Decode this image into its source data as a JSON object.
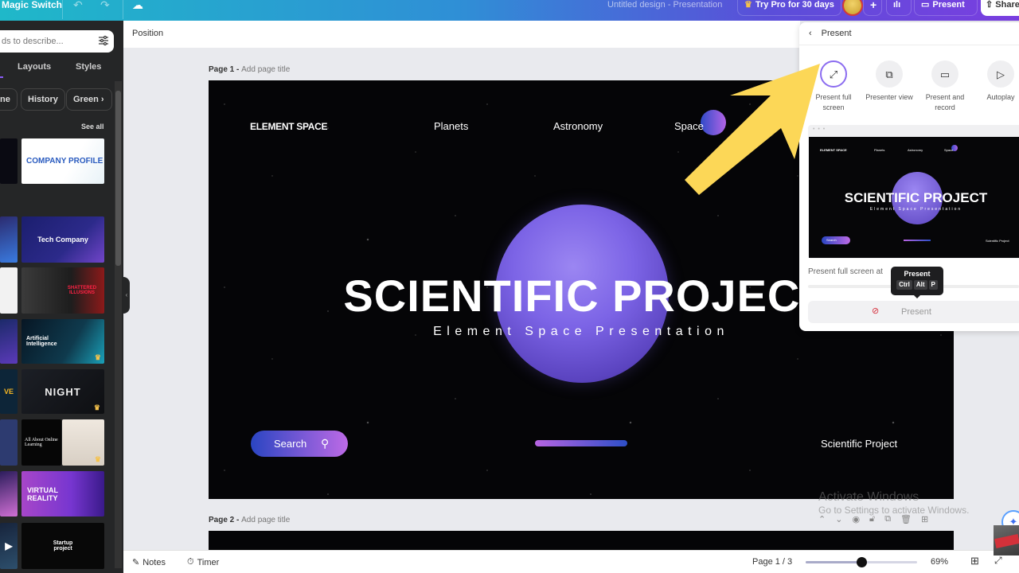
{
  "topbar": {
    "magic_switch": "Magic Switch",
    "undo_icon": "undo-icon",
    "redo_icon": "redo-icon",
    "cloud_icon": "cloud-sync-icon",
    "doc_title": "Untitled design - Presentation",
    "try_pro": "Try Pro for 30 days",
    "add_label": "+",
    "present_label": "Present",
    "share_label": "Share"
  },
  "sidebar": {
    "search_placeholder": "ds to describe...",
    "tabs": [
      "Layouts",
      "Styles"
    ],
    "chips": [
      "ne",
      "History",
      "Green"
    ],
    "see_all": "See all",
    "thumbnails": [
      {
        "label": "COMPANY PROFILE",
        "premium": false
      },
      {
        "label": "Tech Company",
        "premium": false
      },
      {
        "label": "SHATTERED ILLUSIONS",
        "premium": false
      },
      {
        "label": "Artificial Intelligence",
        "premium": true
      },
      {
        "label": "NIGHT",
        "premium": true
      },
      {
        "label": "All About Online Learning",
        "premium": true
      },
      {
        "label": "VIRTUAL REALITY",
        "premium": false
      },
      {
        "label": "Startup project",
        "premium": false
      }
    ]
  },
  "propbar": {
    "position_label": "Position"
  },
  "pages": [
    {
      "label": "Page 1",
      "title_placeholder": "Add page title"
    },
    {
      "label": "Page 2",
      "title_placeholder": "Add page title"
    }
  ],
  "slide": {
    "brand": "ELEMENT SPACE",
    "nav": [
      "Planets",
      "Astronomy",
      "Space"
    ],
    "title": "SCIENTIFIC PROJECT",
    "subtitle": "Element Space Presentation",
    "search_button": "Search",
    "footer": "Scientific Project"
  },
  "present_panel": {
    "title": "Present",
    "options": [
      {
        "label": "Present full screen",
        "icon": "expand-icon",
        "active": true
      },
      {
        "label": "Presenter view",
        "icon": "presenter-view-icon",
        "active": false
      },
      {
        "label": "Present and record",
        "icon": "camera-record-icon",
        "active": false
      },
      {
        "label": "Autoplay",
        "icon": "play-icon",
        "active": false
      }
    ],
    "description": "Present full screen at",
    "description_tail": "e",
    "present_button": "Present",
    "tooltip": {
      "title": "Present",
      "keys": [
        "Ctrl",
        "Alt",
        "P"
      ]
    }
  },
  "watermark": {
    "line1": "Activate Windows",
    "line2": "Go to Settings to activate Windows."
  },
  "bottombar": {
    "notes": "Notes",
    "timer": "Timer",
    "page_indicator": "Page 1 / 3",
    "zoom_percent": "69%",
    "zoom_value": 0.5
  },
  "colors": {
    "accent": "#8b6cf0",
    "arrow": "#fcd757",
    "planet": "#7c64e6"
  }
}
